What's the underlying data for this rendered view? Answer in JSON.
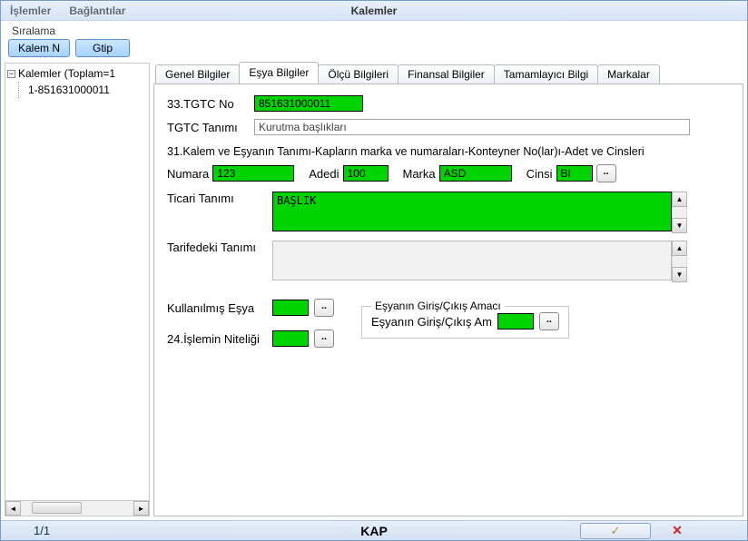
{
  "window": {
    "title": "Kalemler"
  },
  "menu": {
    "islemler": "İşlemler",
    "baglantilar": "Bağlantılar"
  },
  "sort": {
    "label": "Sıralama",
    "kalem_btn": "Kalem N",
    "gtip_btn": "Gtip"
  },
  "tree": {
    "root": "Kalemler (Toplam=1",
    "items": [
      "1-851631000011"
    ]
  },
  "tabs": {
    "genel": "Genel Bilgiler",
    "esya": "Eşya Bilgiler",
    "olcu": "Ölçü Bilgileri",
    "finansal": "Finansal Bilgiler",
    "tamamlayici": "Tamamlayıcı Bilgi",
    "markalar": "Markalar"
  },
  "form": {
    "tgtc_no_label": "33.TGTC No",
    "tgtc_no_value": "851631000011",
    "tgtc_tanim_label": "TGTC Tanımı",
    "tgtc_tanim_value": "Kurutma başlıkları",
    "sect31": "31.Kalem ve Eşyanın Tanımı-Kapların marka ve numaraları-Konteyner No(lar)ı-Adet ve Cinsleri",
    "numara_label": "Numara",
    "numara_value": "123",
    "adedi_label": "Adedi",
    "adedi_value": "100",
    "marka_label": "Marka",
    "marka_value": "ASD",
    "cinsi_label": "Cinsi",
    "cinsi_value": "BI",
    "ticari_label": "Ticari Tanımı",
    "ticari_value": "BAŞLIK",
    "tarifedeki_label": "Tarifedeki Tanımı",
    "tarifedeki_value": "",
    "kullanilmis_label": "Kullanılmış Eşya",
    "kullanilmis_value": "",
    "islem_nitelik_label": "24.İşlemin Niteliği",
    "islem_nitelik_value": "",
    "giris_amac_legend": "Eşyanın Giriş/Çıkış Amacı",
    "giris_amac_label": "Eşyanın Giriş/Çıkış Am",
    "giris_amac_value": ""
  },
  "status": {
    "counter": "1/1",
    "kap": "KAP",
    "ok_glyph": "✓",
    "del_glyph": "✕"
  },
  "icons": {
    "dots": ".."
  }
}
